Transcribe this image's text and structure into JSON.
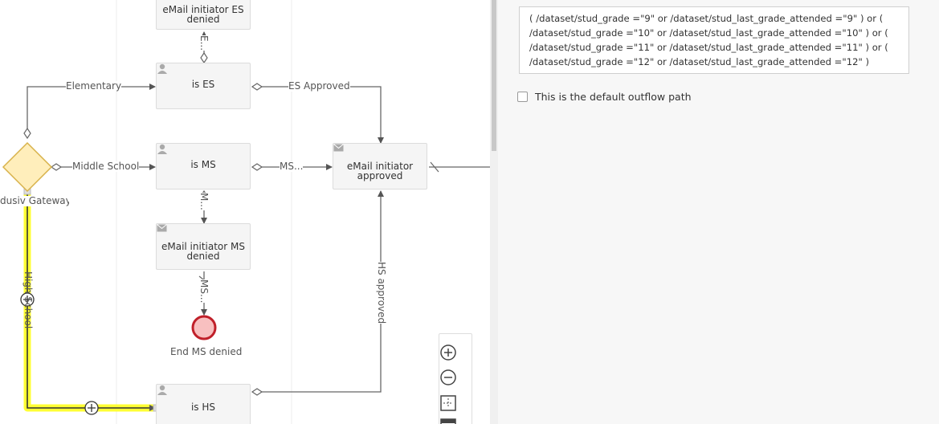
{
  "diagram": {
    "tasks": {
      "es_denied": "eMail initiator ES\ndenied",
      "is_es": "is ES",
      "is_ms": "is MS",
      "approved": "eMail initiator\napproved",
      "ms_denied": "eMail initiator MS\ndenied",
      "is_hs": "is HS"
    },
    "gateway_label": "dusiv   Gateway",
    "end_event_label": "End MS denied",
    "flows": {
      "elementary": "Elementary",
      "middle_school": "Middle School",
      "es_approved": "ES Approved",
      "ms": "MS...",
      "e_up": "E...",
      "m_down": "M...",
      "ms_down": "MS...",
      "high_school": "High School",
      "hs_approved": "HS approved"
    }
  },
  "properties": {
    "condition_expression": "( /dataset/stud_grade =\"9\" or /dataset/stud_last_grade_attended =\"9\" )  or  (\n/dataset/stud_grade =\"10\" or /dataset/stud_last_grade_attended =\"10\" )  or  (\n/dataset/stud_grade =\"11\" or /dataset/stud_last_grade_attended =\"11\" )  or  (\n/dataset/stud_grade =\"12\" or /dataset/stud_last_grade_attended =\"12\" )",
    "default_outflow_label": "This is the default outflow path"
  },
  "colors": {
    "highlight": "#ffff33",
    "gateway_fill": "#ffeebb",
    "gateway_stroke": "#d8b24a",
    "end_fill": "#f8c0c0",
    "end_stroke": "#c0202a"
  }
}
